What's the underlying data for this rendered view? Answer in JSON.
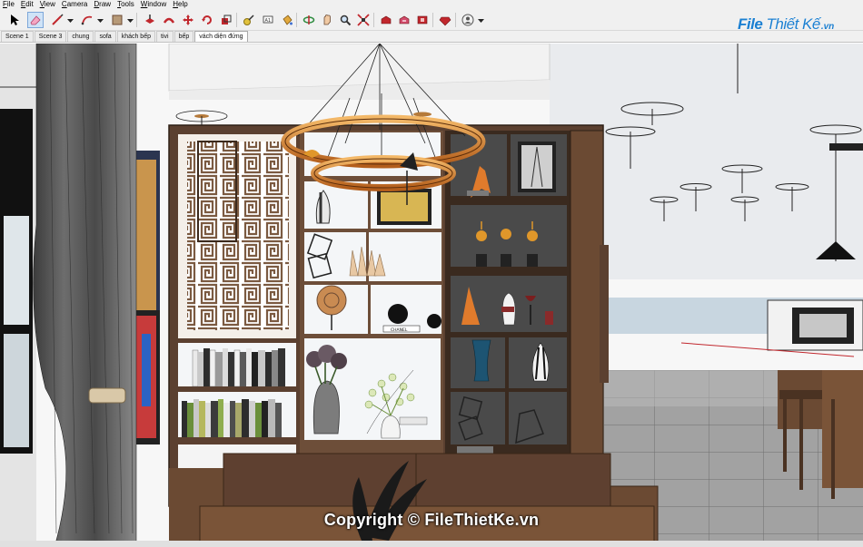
{
  "menu": {
    "items": [
      {
        "underline": "F",
        "rest": "ile"
      },
      {
        "underline": "E",
        "rest": "dit"
      },
      {
        "underline": "V",
        "rest": "iew"
      },
      {
        "underline": "C",
        "rest": "amera"
      },
      {
        "underline": "D",
        "rest": "raw"
      },
      {
        "underline": "T",
        "rest": "ools"
      },
      {
        "underline": "W",
        "rest": "indow"
      },
      {
        "underline": "H",
        "rest": "elp"
      }
    ]
  },
  "toolbar": {
    "tools": [
      {
        "name": "select-icon",
        "active": false
      },
      {
        "name": "eraser-icon",
        "active": true
      },
      {
        "name": "line-icon",
        "active": false
      },
      {
        "name": "arc-icon",
        "active": false
      },
      {
        "name": "rectangle-icon",
        "active": false
      },
      {
        "name": "push-pull-icon",
        "active": false
      },
      {
        "name": "follow-me-icon",
        "active": false
      },
      {
        "name": "move-icon",
        "active": false
      },
      {
        "name": "rotate-icon",
        "active": false
      },
      {
        "name": "scale-icon",
        "active": false
      },
      {
        "name": "tape-measure-icon",
        "active": false
      },
      {
        "name": "text-icon",
        "active": false
      },
      {
        "name": "paint-bucket-icon",
        "active": false
      },
      {
        "name": "orbit-icon",
        "active": false
      },
      {
        "name": "pan-icon",
        "active": false
      },
      {
        "name": "zoom-icon",
        "active": false
      },
      {
        "name": "zoom-extents-icon",
        "active": false
      },
      {
        "name": "warehouse-icon",
        "active": false
      },
      {
        "name": "share-model-icon",
        "active": false
      },
      {
        "name": "extension-warehouse-icon",
        "active": false
      },
      {
        "name": "ruby-icon",
        "active": false
      },
      {
        "name": "account-icon",
        "active": false
      }
    ]
  },
  "logo": {
    "mark_bold": "File",
    "mark_thin": "Thiết Kế",
    "suffix": ".vn"
  },
  "scenes": {
    "tabs": [
      {
        "label": "Scene 1",
        "active": false
      },
      {
        "label": "Scene 3",
        "active": false
      },
      {
        "label": "chung",
        "active": false
      },
      {
        "label": "sofa",
        "active": false
      },
      {
        "label": "khách bếp",
        "active": false
      },
      {
        "label": "tivi",
        "active": false
      },
      {
        "label": "bếp",
        "active": false
      },
      {
        "label": "vách diện đứng",
        "active": true
      }
    ]
  },
  "viewport": {
    "watermark": "Copyright © FileThietKe.vn",
    "book_label": "CHANEL"
  },
  "colors": {
    "toolbar_bg": "#f0f0f0",
    "wood": "#6b4a33",
    "wood_dark": "#4a3222",
    "wall": "#e8e8e8",
    "chandelier": "#d98a3c",
    "floor": "#9c9c9c",
    "accent": "#1b7fd1"
  }
}
